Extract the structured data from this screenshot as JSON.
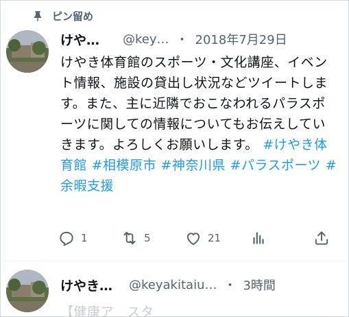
{
  "pinned": {
    "label": "ピン留め",
    "icon": "pin-icon"
  },
  "tweet1": {
    "display_name": "けや…",
    "handle": "@key…",
    "separator": "・",
    "time": "2018年7月29日",
    "body_text": "けやき体育館のスポーツ・文化講座、イベント情報、施設の貸出し状況などツイートします。また、主に近隣でおこなわれるパラスポーツに関しての情報についてもお伝えしていきます。よろしくお願いします。",
    "hashtags": [
      "#けやき体育館",
      "#相模原市",
      "#神奈川県",
      "#パラスポーツ",
      "#余暇支援"
    ],
    "actions": {
      "reply_count": "1",
      "retweet_count": "5",
      "like_count": "21",
      "views_icon": "bar-chart-icon",
      "share_icon": "share-icon"
    }
  },
  "tweet2": {
    "display_name": "けやき…",
    "handle": "@keyakitaiu…",
    "separator": "・",
    "time": "3時間",
    "faded_text": "【健康ア　スタ"
  },
  "colors": {
    "accent": "#1d9bf0",
    "text": "#0f1419",
    "muted": "#536471",
    "border": "#cfd9de"
  }
}
